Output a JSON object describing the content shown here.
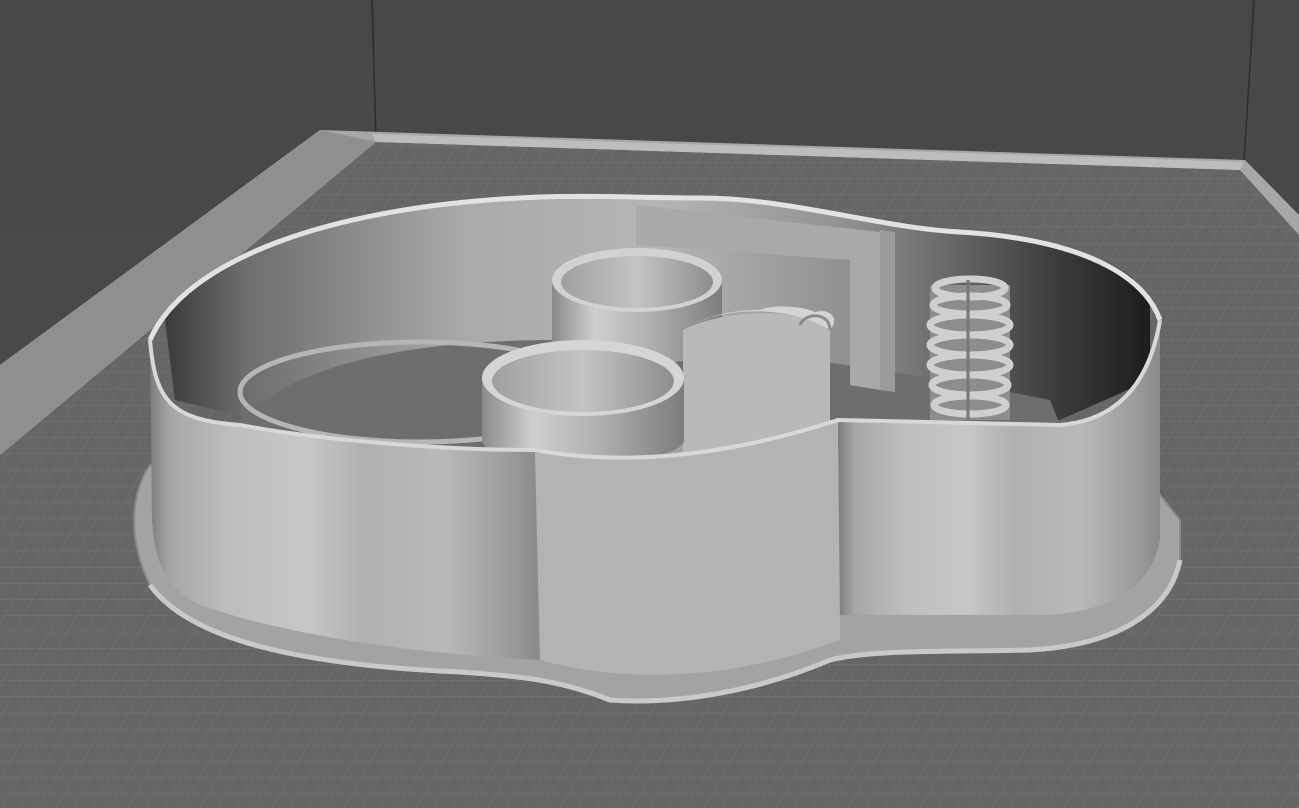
{
  "viewport": {
    "description_free": true,
    "colors": {
      "background_wall": "#494949",
      "bed_floor": "#666666",
      "bed_grid_line": "#7a7a7a",
      "bed_frame": "#a9a9a9",
      "model_light": "#c9c9c9",
      "model_mid": "#a8a8a8",
      "model_dark": "#555555"
    },
    "bed": {
      "grid": true
    },
    "model": {
      "icon": "3d-model-icon"
    }
  }
}
